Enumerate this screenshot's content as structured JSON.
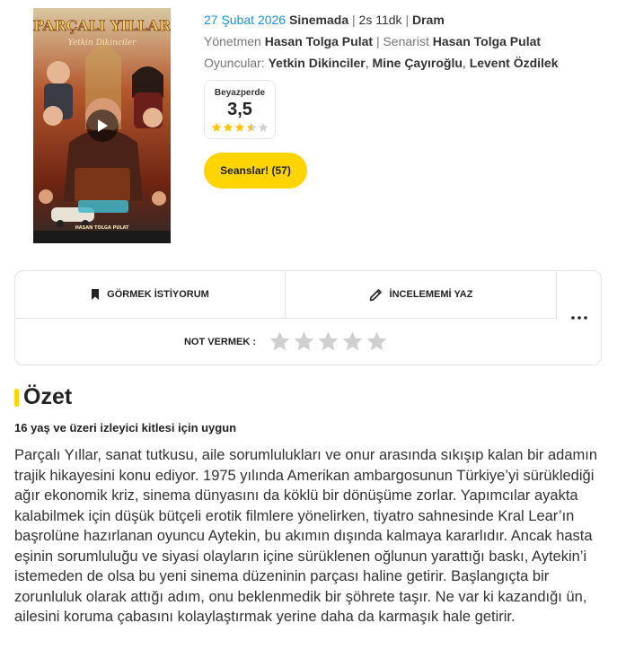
{
  "poster": {
    "title_art": "PARÇALI YILLAR",
    "subtitle_art": "Yetkin Dikinciler",
    "credit_art": "HASAN TOLGA PULAT"
  },
  "meta": {
    "date": "27 Şubat 2026",
    "release_status": "Sinemada",
    "sep1": "|",
    "duration": "2s 11dk",
    "sep2": "|",
    "genre": "Dram",
    "director_label": "Yönetmen",
    "director": "Hasan Tolga Pulat",
    "sep3": "|",
    "writer_label": "Senarist",
    "writer": "Hasan Tolga Pulat",
    "cast_label": "Oyuncular:",
    "cast": [
      "Yetkin Dikinciler",
      "Mine Çayıroğlu",
      "Levent Özdilek"
    ],
    "cast_sep": ","
  },
  "rating": {
    "label": "Beyazperde",
    "score": "3,5",
    "value": 3.5,
    "max": 5
  },
  "seans_button": "Seanslar! (57)",
  "actions": {
    "watch_label": "GÖRMEK İSTİYORUM",
    "review_label": "İNCELEMEMİ YAZ",
    "rate_label": "NOT VERMEK :",
    "rate_stars_count": 5
  },
  "summary": {
    "title": "Özet",
    "age_note": "16 yaş ve üzeri izleyici kitlesi için uygun",
    "text": "Parçalı Yıllar, sanat tutkusu, aile sorumlulukları ve onur arasında sıkışıp kalan bir adamın trajik hikayesini konu ediyor. 1975 yılında Amerikan ambargosunun Türkiye’yi sürüklediği ağır ekonomik kriz, sinema dünyasını da köklü bir dönüşüme zorlar. Yapımcılar ayakta kalabilmek için düşük bütçeli erotik filmlere yönelirken, tiyatro sahnesinde Kral Lear’ın başrolüne hazırlanan oyuncu Aytekin, bu akımın dışında kalmaya kararlıdır. Ancak hasta eşinin sorumluluğu ve siyasi olayların içine sürüklenen oğlunun yarattığı baskı, Aytekin’i istemeden de olsa bu yeni sinema düzeninin parçası haline getirir. Başlangıçta bir zorunluluk olarak attığı adım, onu beklenmedik bir şöhrete taşır. Ne var ki kazandığı ün, ailesini koruma çabasını kolaylaştırmak yerine daha da karmaşık hale getirir."
  },
  "colors": {
    "accent": "#ffd400",
    "link": "#1e8fd6",
    "star_filled": "#ffc400",
    "star_empty": "#cfcfcf"
  },
  "icons": {
    "play": "play-icon",
    "bookmark": "bookmark-icon",
    "pencil": "pencil-icon",
    "more": "more-icon",
    "star": "star-icon"
  }
}
